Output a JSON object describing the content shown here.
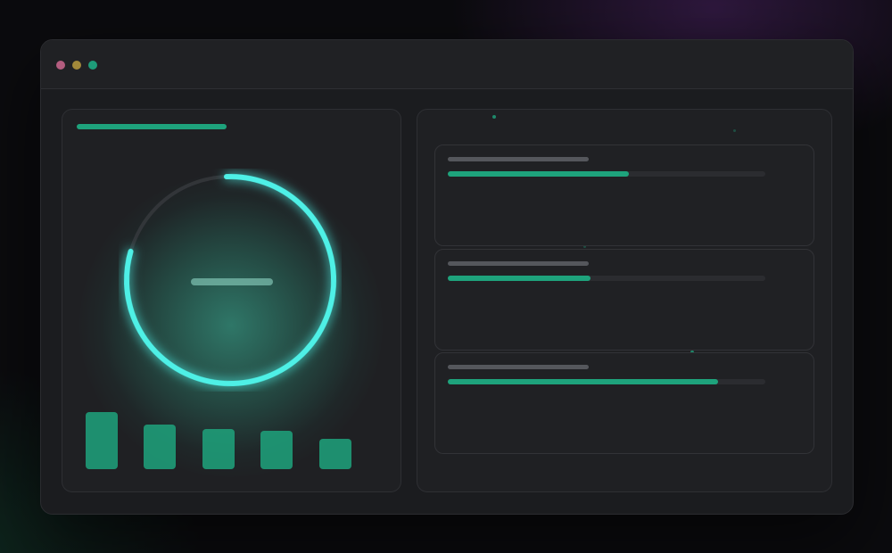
{
  "colors": {
    "accent": "#1ea37c",
    "gauge_ring": "#4ef0e6",
    "gauge_track": "#3b3d41",
    "label_bar": "#55575c",
    "center_dash": "#8fd6c5",
    "window_red": "#b35d7f",
    "window_yellow": "#a2893a",
    "window_green": "#1e9c79"
  },
  "window_controls": [
    "close-icon",
    "minimize-icon",
    "maximize-icon"
  ],
  "gauge": {
    "value": 0.8
  },
  "bar_chart": {
    "values": [
      64,
      50,
      45,
      43,
      34
    ]
  },
  "progress_cards": [
    {
      "progress": 0.57
    },
    {
      "progress": 0.45
    },
    {
      "progress": 0.85
    }
  ]
}
